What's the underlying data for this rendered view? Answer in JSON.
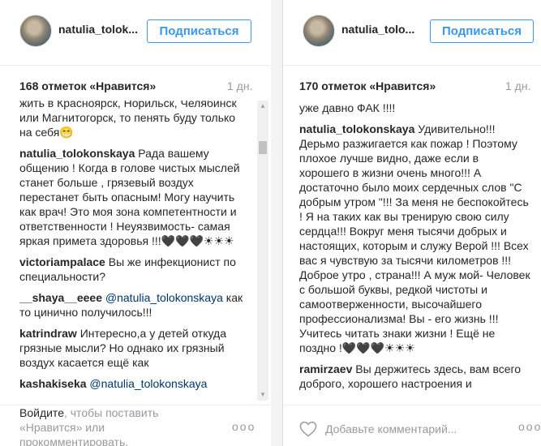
{
  "left_post": {
    "username": "natulia_tolok...",
    "follow_label": "Подписаться",
    "likes": "168 отметок «Нравится»",
    "time": "1 дн.",
    "comments": [
      {
        "author": "",
        "text": "жить в Красноярск, Норильск, Челябинск или Магнитогорск, то пенять буду только на себя😁"
      },
      {
        "author": "natulia_tolokonskaya",
        "text": "Рада вашему общению ! Когда в голове чистых мыслей станет больше , грязевый воздух перестанет быть опасным! Могу научить как врач! Это моя зона компетентности и ответственности ! Неуязвимость- самая яркая примета здоровья !!!",
        "emoji": "🖤🖤🖤☀☀☀"
      },
      {
        "author": "victoriampalace",
        "text": "Вы же инфекционист по специальности?"
      },
      {
        "author": "__shaya__eeee",
        "mention": "@natulia_tolokonskaya",
        "text": "как то цинично получилось!!!"
      },
      {
        "author": "katrindraw",
        "text": "Интересно,а у детей откуда грязные мысли? Но однако их грязный воздух касается ещё как"
      },
      {
        "author": "kashakiseka",
        "mention": "@natulia_tolokonskaya",
        "text": ""
      }
    ],
    "login_link": "Войдите",
    "login_rest": ", чтобы поставить «Нравится» или прокомментировать.",
    "more": "ooo"
  },
  "right_post": {
    "username": "natulia_tolo...",
    "follow_label": "Подписаться",
    "likes": "170 отметок «Нравится»",
    "time": "1 дн.",
    "comments": [
      {
        "author": "",
        "text": "уже давно ФАК !!!!"
      },
      {
        "author": "natulia_tolokonskaya",
        "text": "Удивительно!!! Дерьмо разжигается как пожар ! Поэтому плохое лучше видно, даже если в хорошего в жизни очень много!!! А достаточно было моих сердечных слов \"С добрым утром \"!!! За меня не беспокойтесь ! Я на таких как вы тренирую свою силу сердца!!! Вокруг меня тысячи добрых и настоящих, которым и служу Верой !!! Всех вас я чувствую за тысячи километров !!! Доброе утро , страна!!! А муж мой- Человек с большой буквы, редкой чистоты и самоотверженности, высочайшего профессионализма! Вы - его жизнь !!! Учитесь читать знаки жизни ! Ещё не поздно !",
        "emoji": "🖤🖤🖤☀☀☀"
      },
      {
        "author": "ramirzaev",
        "text": "Вы держитесь здесь, вам всего доброго, хорошего настроения и"
      }
    ],
    "comment_placeholder": "Добавьте комментарий...",
    "more": "ooo"
  }
}
